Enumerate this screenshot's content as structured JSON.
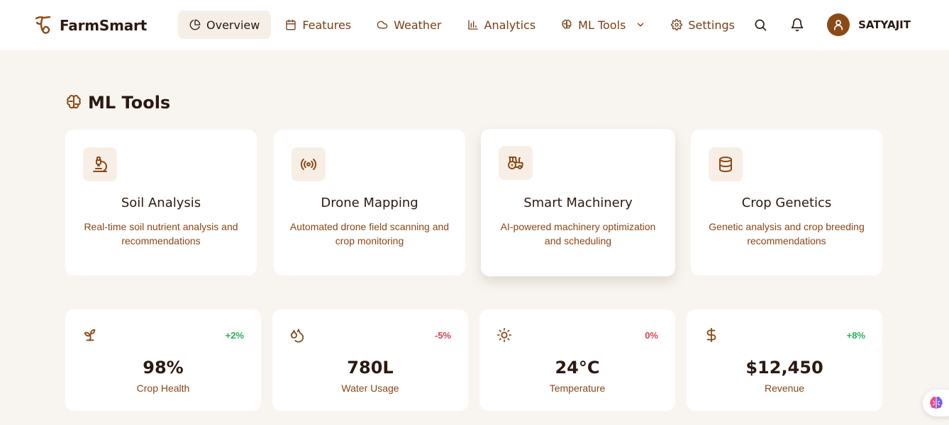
{
  "brand": {
    "name": "FarmSmart"
  },
  "nav": {
    "items": [
      {
        "label": "Overview",
        "icon": "pie-chart-icon",
        "active": true
      },
      {
        "label": "Features",
        "icon": "calendar-icon"
      },
      {
        "label": "Weather",
        "icon": "cloud-icon"
      },
      {
        "label": "Analytics",
        "icon": "bar-chart-icon"
      },
      {
        "label": "ML Tools",
        "icon": "brain-icon",
        "dropdown": true
      },
      {
        "label": "Settings",
        "icon": "gear-icon"
      }
    ]
  },
  "user": {
    "name": "SATYAJIT"
  },
  "section": {
    "title": "ML Tools"
  },
  "tools": [
    {
      "title": "Soil Analysis",
      "desc": "Real-time soil nutrient analysis and recommendations",
      "icon": "microscope-icon"
    },
    {
      "title": "Drone Mapping",
      "desc": "Automated drone field scanning and crop monitoring",
      "icon": "radio-signal-icon"
    },
    {
      "title": "Smart Machinery",
      "desc": "AI-powered machinery optimization and scheduling",
      "icon": "tractor-icon"
    },
    {
      "title": "Crop Genetics",
      "desc": "Genetic analysis and crop breeding recommendations",
      "icon": "database-icon"
    }
  ],
  "stats": [
    {
      "value": "98%",
      "label": "Crop Health",
      "change": "+2%",
      "trend": "up",
      "icon": "sprout-icon"
    },
    {
      "value": "780L",
      "label": "Water Usage",
      "change": "-5%",
      "trend": "down",
      "icon": "droplets-icon"
    },
    {
      "value": "24°C",
      "label": "Temperature",
      "change": "0%",
      "trend": "down",
      "icon": "sun-icon"
    },
    {
      "value": "$12,450",
      "label": "Revenue",
      "change": "+8%",
      "trend": "up",
      "icon": "dollar-icon"
    }
  ],
  "colors": {
    "brand": "#8a4a17",
    "background": "#f8f5f1",
    "positive": "#27b05b",
    "negative": "#e0404c"
  }
}
